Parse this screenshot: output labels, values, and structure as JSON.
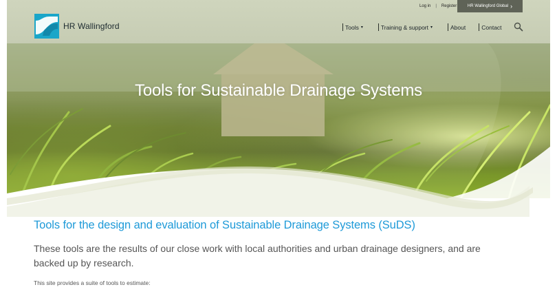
{
  "header": {
    "logo_text": "HR Wallingford",
    "util_nav": {
      "login": "Log in",
      "separator": "|",
      "register": "Register"
    },
    "global_button": {
      "label": "HR Wallingford Global",
      "chevron": "›"
    },
    "main_nav": [
      {
        "label": "Tools",
        "caret": "▾"
      },
      {
        "label": "Training & support",
        "caret": "▾"
      },
      {
        "label": "About"
      },
      {
        "label": "Contact"
      }
    ]
  },
  "hero": {
    "title": "Tools for Sustainable Drainage Systems"
  },
  "content": {
    "heading": "Tools for the design and evaluation of Sustainable Drainage Systems (SuDS)",
    "lead": "These tools are the results of our close work with local authorities and urban drainage designers, and are backed up by research.",
    "intro": "This site provides a suite of tools to estimate:"
  },
  "colors": {
    "accent": "#1e9ad8",
    "logo": "#1aa6c9",
    "header_bg": "#cfd5bd",
    "global_btn": "#5f6357"
  },
  "icons": {
    "search": "search-icon",
    "logo": "hr-wallingford-logo-icon"
  }
}
